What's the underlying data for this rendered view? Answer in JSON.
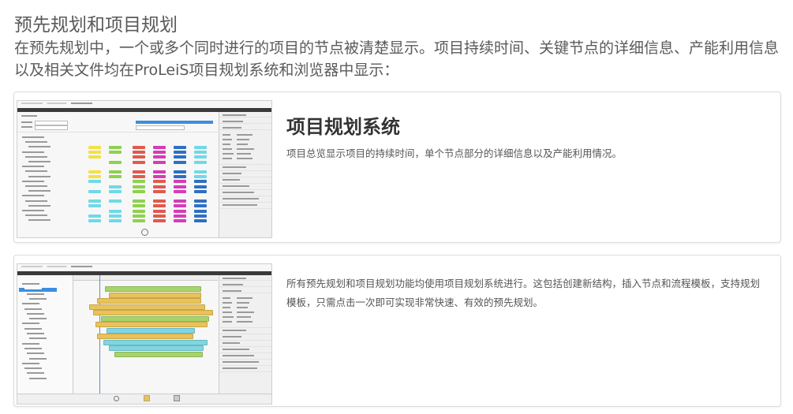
{
  "header": {
    "title": "预先规划和项目规划",
    "description": "在预先规划中，一个或多个同时进行的项目的节点被清楚显示。项目持续时间、关键节点的详细信息、产能利用信息以及相关文件均在ProLeiS项目规划系统和浏览器中显示："
  },
  "cards": [
    {
      "title": "项目规划系统",
      "text": "项目总览显示项目的持续时间，单个节点部分的详细信息以及产能利用情况。",
      "screenshot": "project-overview-screenshot"
    },
    {
      "title": "",
      "text": "所有预先规划和项目规划功能均使用项目规划系统进行。这包括创建新结构，插入节点和流程模板，支持规划模板，只需点击一次即可实现非常快速、有效的预先规划。",
      "screenshot": "gantt-planning-screenshot"
    }
  ],
  "colors": {
    "cell_green": "#8ed14f",
    "cell_yellow": "#f3e046",
    "cell_red": "#e05a4f",
    "cell_magenta": "#d63bb8",
    "cell_blue": "#2f6fc4",
    "cell_cyan": "#6fd9e8",
    "gantt_gold": "#e9c25a",
    "gantt_cyan": "#7fd6e0",
    "gantt_green": "#a7d46a",
    "selection_blue": "#3c8ee0"
  }
}
